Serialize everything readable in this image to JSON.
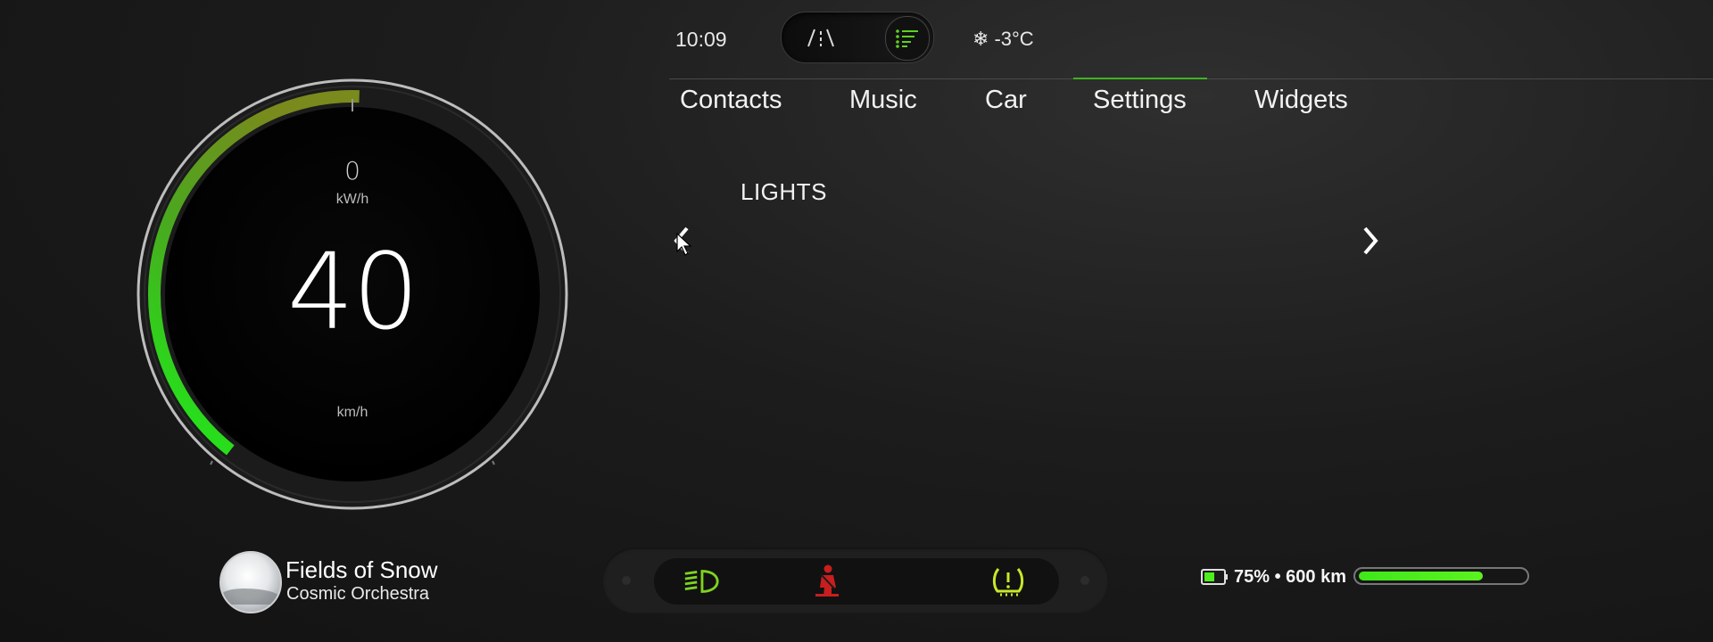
{
  "dashboard": {
    "power_value": "0",
    "power_unit": "kW/h",
    "speed_value": "40",
    "speed_unit": "km/h",
    "speed_level": 0.45
  },
  "status": {
    "time": "10:09",
    "temperature": "-3°C",
    "weather_icon": "snowflake-icon",
    "mode_icons": [
      "road-icon",
      "list-icon"
    ]
  },
  "tabs": [
    {
      "label": "Contacts"
    },
    {
      "label": "Music"
    },
    {
      "label": "Car"
    },
    {
      "label": "Settings",
      "active": true
    },
    {
      "label": "Widgets"
    }
  ],
  "content": {
    "section_title": "LIGHTS"
  },
  "media": {
    "track_title": "Fields of Snow",
    "artist": "Cosmic Orchestra"
  },
  "warning_lamps": [
    {
      "icon": "headlight-icon",
      "color": "#7ed321"
    },
    {
      "icon": "seatbelt-icon",
      "color": "#c81e1e"
    },
    {
      "icon": "tire-pressure-icon",
      "color": "#c8e82a"
    }
  ],
  "battery": {
    "text": "75% • 600 km",
    "level": 0.75,
    "accent": "#4cee1c"
  },
  "colors": {
    "accent_green": "#3fb31f",
    "background": "#1c1c1c"
  }
}
